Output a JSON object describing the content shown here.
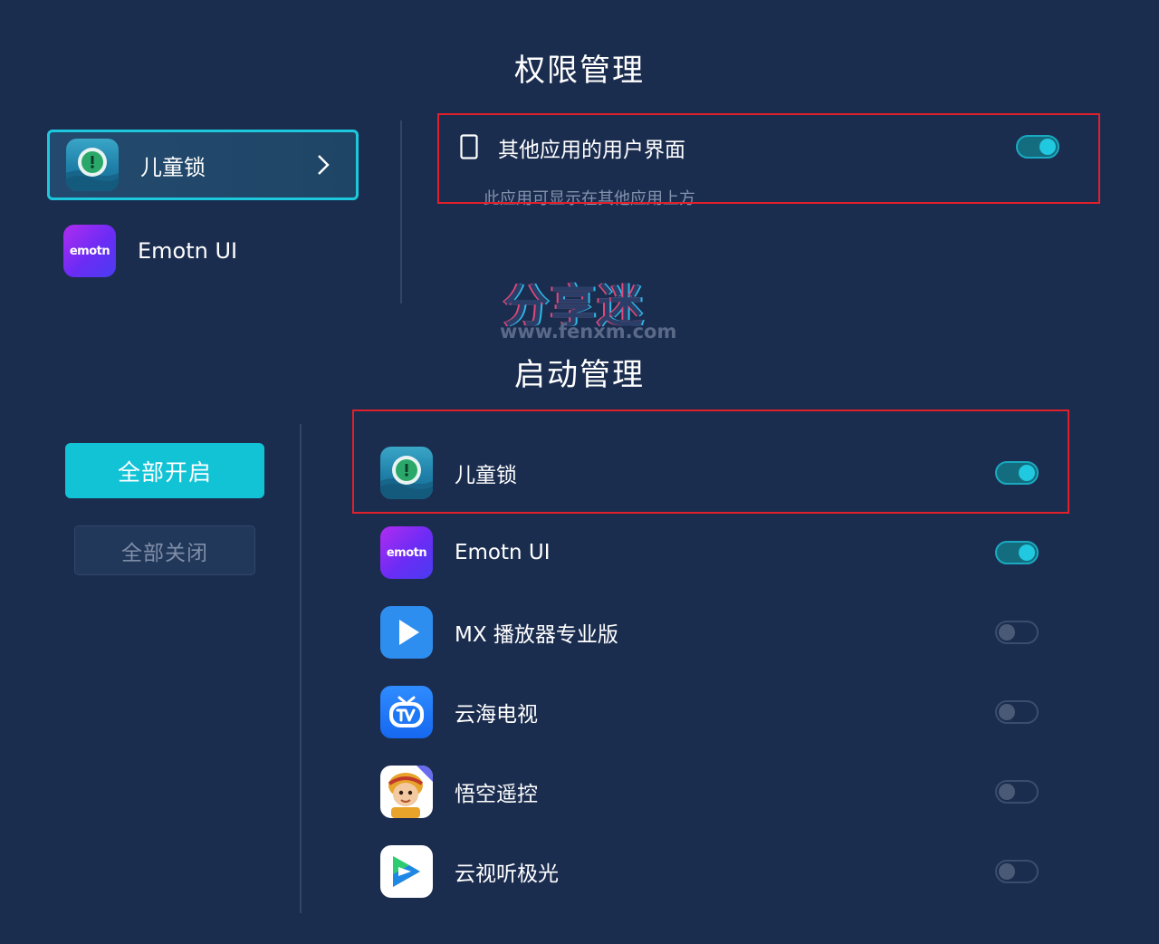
{
  "permission": {
    "title": "权限管理",
    "apps": [
      {
        "name": "儿童锁",
        "icon": "childlock-app-icon",
        "selected": true
      },
      {
        "name": "Emotn UI",
        "icon": "emotn-app-icon",
        "selected": false
      }
    ],
    "chevron_icon": "chevron-right-icon",
    "setting": {
      "icon": "phone-outline-icon",
      "title": "其他应用的用户界面",
      "subtitle": "此应用可显示在其他应用上方",
      "enabled": true
    }
  },
  "watermark": {
    "text": "分享迷",
    "url": "www.fenxm.com"
  },
  "startup": {
    "title": "启动管理",
    "enable_all_label": "全部开启",
    "disable_all_label": "全部关闭",
    "apps": [
      {
        "name": "儿童锁",
        "icon": "childlock-app-icon",
        "enabled": true
      },
      {
        "name": "Emotn UI",
        "icon": "emotn-app-icon",
        "enabled": true
      },
      {
        "name": "MX 播放器专业版",
        "icon": "mx-player-icon",
        "enabled": false
      },
      {
        "name": "云海电视",
        "icon": "yunhai-tv-icon",
        "enabled": false
      },
      {
        "name": "悟空遥控",
        "icon": "wukong-remote-icon",
        "enabled": false
      },
      {
        "name": "云视听极光",
        "icon": "yunshiting-icon",
        "enabled": false
      }
    ]
  },
  "emotn_logo_text": "emotn",
  "colors": {
    "background": "#1b2d4f",
    "accent": "#12c3d6",
    "highlight_box": "#e0202a"
  }
}
